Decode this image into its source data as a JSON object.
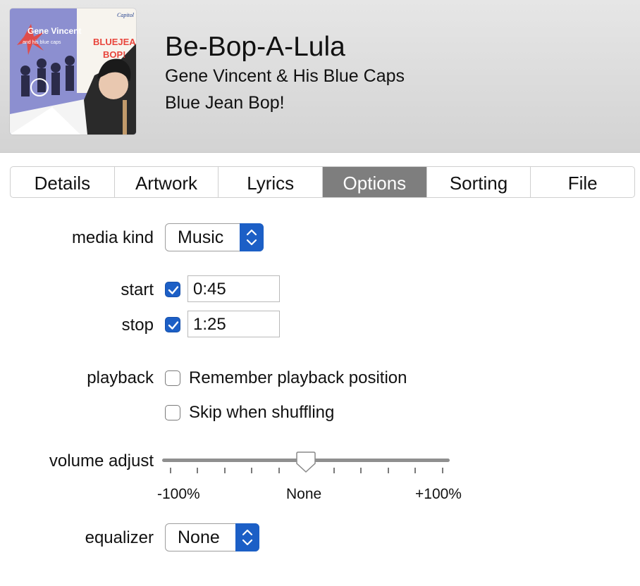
{
  "track": {
    "title": "Be-Bop-A-Lula",
    "artist": "Gene Vincent & His Blue Caps",
    "album": "Blue Jean Bop!"
  },
  "artwork": {
    "band_text_1": "Gene Vincent",
    "band_text_2": "and his blue caps",
    "album_text_1": "BLUEJEAN",
    "album_text_2": "BOP!",
    "label_logo": "Capitol"
  },
  "tabs": [
    {
      "label": "Details"
    },
    {
      "label": "Artwork"
    },
    {
      "label": "Lyrics"
    },
    {
      "label": "Options"
    },
    {
      "label": "Sorting"
    },
    {
      "label": "File"
    }
  ],
  "active_tab": "Options",
  "options": {
    "media_kind": {
      "label": "media kind",
      "value": "Music"
    },
    "start": {
      "label": "start",
      "checked": true,
      "value": "0:45"
    },
    "stop": {
      "label": "stop",
      "checked": true,
      "value": "1:25"
    },
    "playback": {
      "label": "playback",
      "remember_position": {
        "label": "Remember playback position",
        "checked": false
      },
      "skip_shuffling": {
        "label": "Skip when shuffling",
        "checked": false
      }
    },
    "volume_adjust": {
      "label": "volume adjust",
      "min_label": "-100%",
      "mid_label": "None",
      "max_label": "+100%",
      "value_percent": 0
    },
    "equalizer": {
      "label": "equalizer",
      "value": "None"
    }
  },
  "colors": {
    "accent": "#1c5fc6",
    "active_tab": "#7e7e7e",
    "header_bg": "#dcdcdc"
  },
  "icons": {
    "checkmark": "checkmark-icon",
    "stepper": "up-down-chevron-icon"
  }
}
